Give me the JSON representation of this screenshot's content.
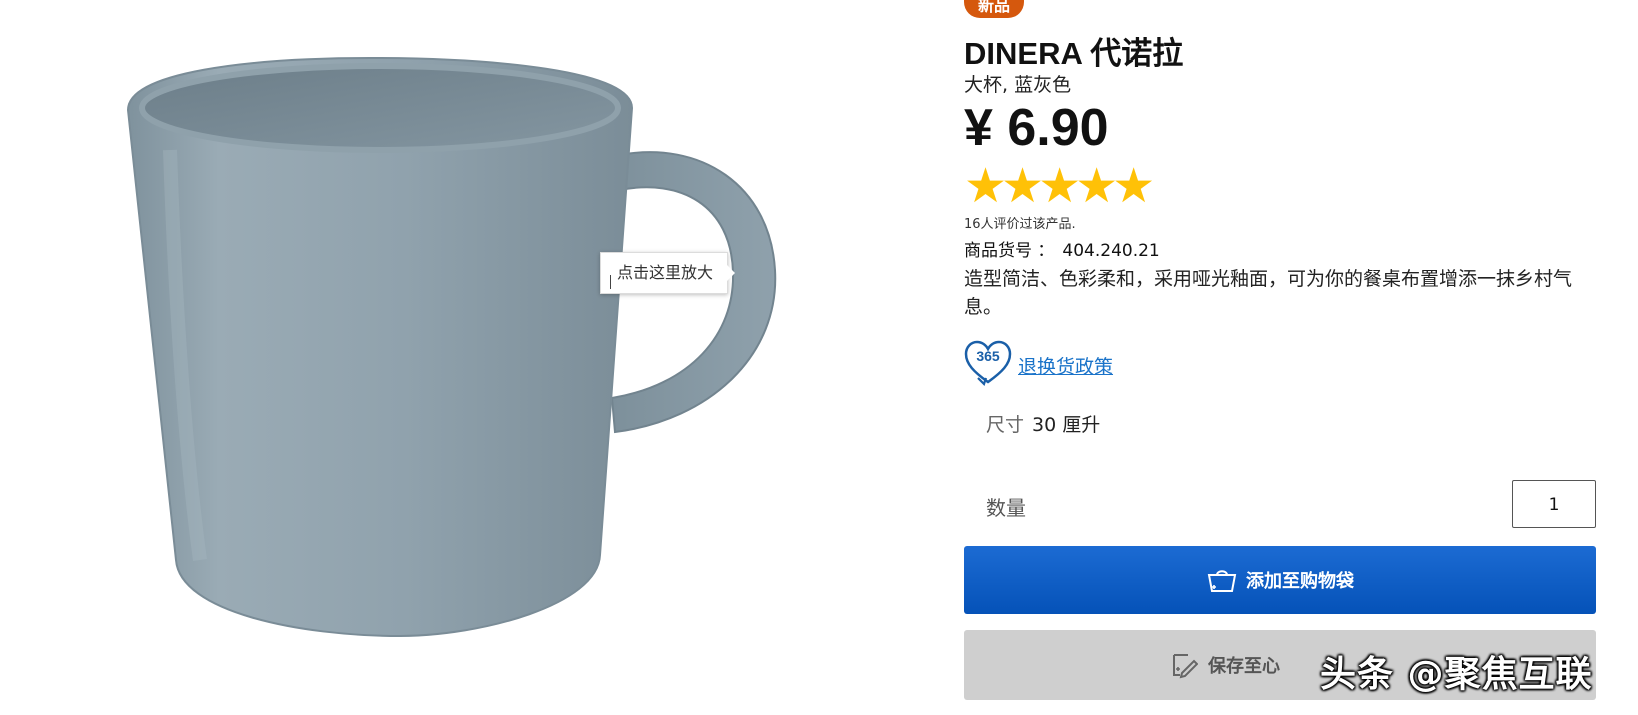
{
  "product": {
    "badge": "新品",
    "name": "DINERA 代诺拉",
    "subtitle": "大杯, 蓝灰色",
    "price": "¥ 6.90",
    "rating": {
      "value": 5,
      "max": 5,
      "count_text": "16人评价过该产品."
    },
    "sku_label": "商品货号 ：",
    "sku_value": "404.240.21",
    "description": "造型简洁、色彩柔和，采用哑光釉面，可为你的餐桌布置增添一抹乡村气息。",
    "image_alt_tip": "点击这里放大",
    "mug_color": "#8c9ea9"
  },
  "policy": {
    "badge_number": "365",
    "link_text": "退换货政策",
    "icon": "heart-365-icon",
    "color": "#1a73c9"
  },
  "size": {
    "label": "尺寸",
    "value": "30 厘升"
  },
  "quantity": {
    "label": "数量",
    "value": "1"
  },
  "actions": {
    "add_to_cart": "添加至购物袋",
    "add_to_cart_icon": "shopping-bag-icon",
    "save_to_wishlist": "保存至心",
    "save_to_wishlist_icon": "wishlist-pencil-icon",
    "cart_color": "#0058a3"
  },
  "watermark": "头条 @聚焦互联",
  "colors": {
    "badge": "#d5580d",
    "star": "#ffc107",
    "link": "#1a73c9",
    "wish_button": "#cfcfcf"
  }
}
